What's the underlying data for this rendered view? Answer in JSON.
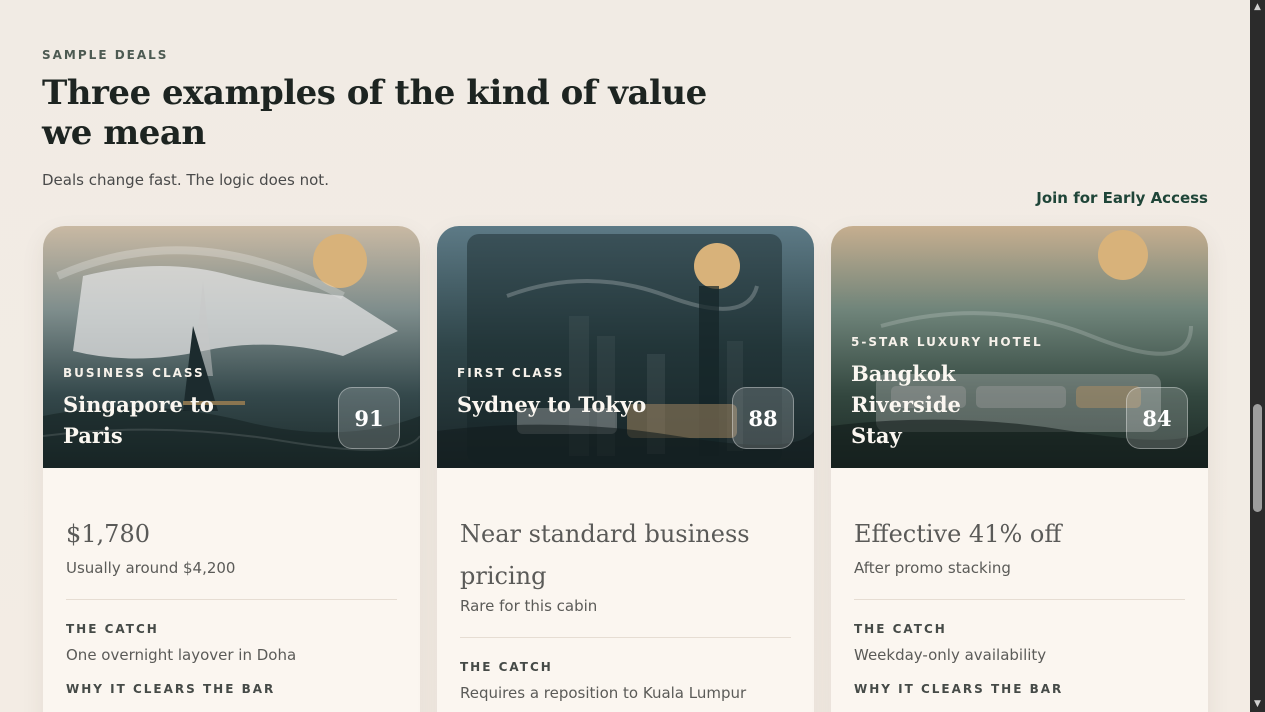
{
  "section": {
    "eyebrow": "SAMPLE DEALS",
    "headline": "Three examples of the kind of value we mean",
    "subhead": "Deals change fast. The logic does not.",
    "cta": "Join for Early Access"
  },
  "cards": [
    {
      "category": "BUSINESS CLASS",
      "title": "Singapore to Paris",
      "score": "91",
      "price": "$1,780",
      "price_note": "Usually around $4,200",
      "catch_label": "THE CATCH",
      "catch": "One overnight layover in Doha",
      "why_label": "WHY IT CLEARS THE BAR"
    },
    {
      "category": "FIRST CLASS",
      "title": "Sydney to Tokyo",
      "score": "88",
      "price": "Near standard business pricing",
      "price_note": "Rare for this cabin",
      "catch_label": "THE CATCH",
      "catch": "Requires a reposition to Kuala Lumpur"
    },
    {
      "category": "5-STAR LUXURY HOTEL",
      "title": "Bangkok Riverside Stay",
      "score": "84",
      "price": "Effective 41% off",
      "price_note": "After promo stacking",
      "catch_label": "THE CATCH",
      "catch": "Weekday-only availability",
      "why_label": "WHY IT CLEARS THE BAR"
    }
  ],
  "colors": {
    "accent": "#1f4538",
    "sun": "#d8b27a",
    "page_bg": "#f2ebe3"
  }
}
